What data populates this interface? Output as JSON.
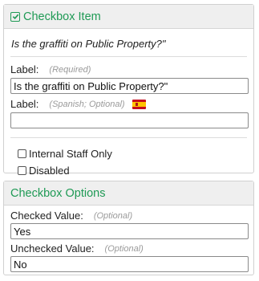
{
  "item_panel": {
    "title": "Checkbox Item",
    "question_preview": "Is the graffiti on Public Property?\"",
    "label_field": {
      "label": "Label:",
      "hint": "(Required)",
      "value": "Is the graffiti on Public Property?\""
    },
    "spanish_label_field": {
      "label": "Label:",
      "hint": "(Spanish; Optional)",
      "value": "",
      "flag_icon": "spain-flag-icon"
    },
    "checkboxes": [
      {
        "label": "Internal Staff Only",
        "checked": false
      },
      {
        "label": "Disabled",
        "checked": false
      }
    ]
  },
  "options_panel": {
    "title": "Checkbox Options",
    "checked_value": {
      "label": "Checked Value:",
      "hint": "(Optional)",
      "value": "Yes"
    },
    "unchecked_value": {
      "label": "Unchecked Value:",
      "hint": "(Optional)",
      "value": "No"
    }
  },
  "colors": {
    "accent_green": "#1f9a55",
    "header_bg": "#efefef",
    "hint_gray": "#9a9a9a"
  }
}
